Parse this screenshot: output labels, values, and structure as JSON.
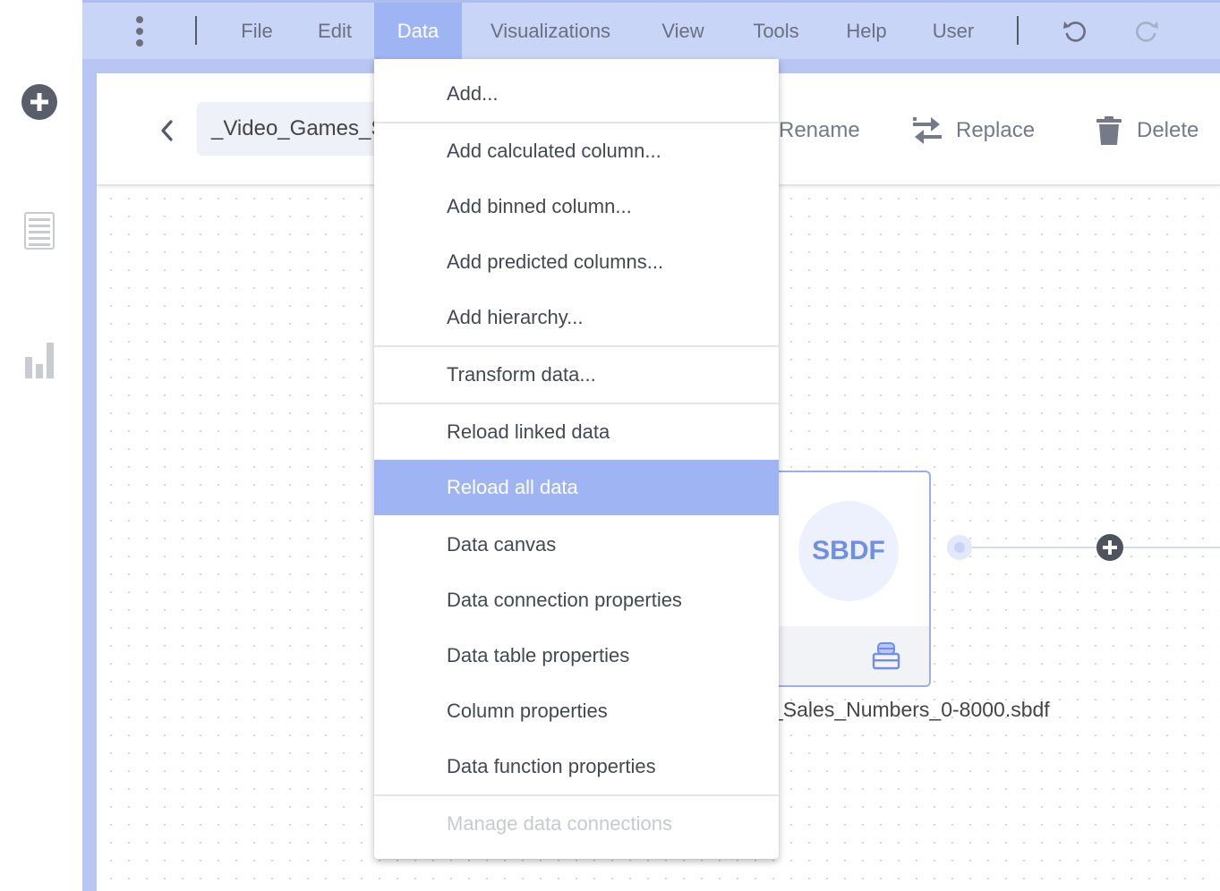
{
  "menubar": {
    "items": [
      {
        "label": "File"
      },
      {
        "label": "Edit"
      },
      {
        "label": "Data"
      },
      {
        "label": "Visualizations"
      },
      {
        "label": "View"
      },
      {
        "label": "Tools"
      },
      {
        "label": "Help"
      },
      {
        "label": "User"
      }
    ],
    "active": "Data"
  },
  "toolbar": {
    "source_name": "_Video_Games_Sales_Numbers_0-8000.sbdf",
    "rename_label": "Rename",
    "replace_label": "Replace",
    "delete_label": "Delete"
  },
  "node": {
    "type_label": "SBDF",
    "caption": "_Sales_Numbers_0-8000.sbdf"
  },
  "data_menu": {
    "items": [
      {
        "label": "Add..."
      },
      {
        "label": "Add calculated column..."
      },
      {
        "label": "Add binned column..."
      },
      {
        "label": "Add predicted columns..."
      },
      {
        "label": "Add hierarchy..."
      },
      {
        "label": "Transform data..."
      },
      {
        "label": "Reload linked data"
      },
      {
        "label": "Reload all data"
      },
      {
        "label": "Data canvas"
      },
      {
        "label": "Data connection properties"
      },
      {
        "label": "Data table properties"
      },
      {
        "label": "Column properties"
      },
      {
        "label": "Data function properties"
      },
      {
        "label": "Manage data connections"
      }
    ],
    "highlighted": "Reload all data",
    "disabled": [
      "Manage data connections"
    ]
  },
  "colors": {
    "accent": "#9fb4f3",
    "menubar_bg": "#c9d5f7",
    "node_text": "#6f8ee6"
  }
}
